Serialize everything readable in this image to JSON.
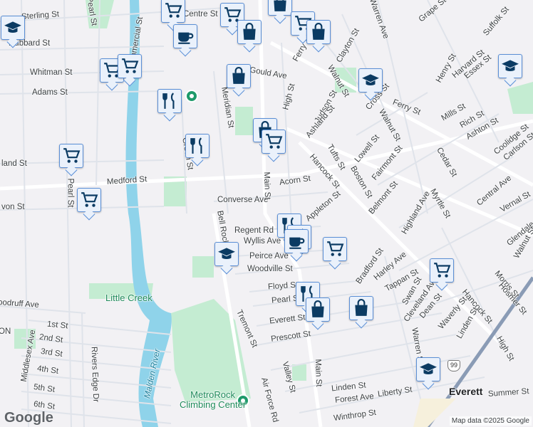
{
  "map": {
    "streets": [
      "Sterling St",
      "Hubbard St",
      "Whitman St",
      "Adams St",
      "Medford St",
      "Pearl St",
      "Converse Ave",
      "Acorn St",
      "Main St",
      "Regent Rd",
      "Wyllis Ave",
      "Bell Rock",
      "Peirce Ave",
      "Woodville St",
      "Floyd St",
      "Pearl St",
      "Everett St",
      "Prescott St",
      "Tremont St",
      "Valley St",
      "Air Force Rd",
      "Main St",
      "Linden St",
      "Forest Ave",
      "Liberty St",
      "Winthrop St",
      "Summer St",
      "Middlesex Ave",
      "Rivers Edge Dr",
      "1st St",
      "2nd St",
      "3rd St",
      "4th St",
      "5th St",
      "6th St",
      "oodruff Ave",
      "Meridian St",
      "Green St",
      "Commercial St",
      "Pearl St",
      "Centre St",
      "Ferry St",
      "High St",
      "Judson St",
      "Ashland St",
      "Walnut St",
      "Clayton St",
      "Cross St",
      "Ferry St",
      "Walnut St",
      "Tufts St",
      "Hancock St",
      "Lowell St",
      "Boston St",
      "Fairmont St",
      "Belmont St",
      "Appleton St",
      "Cedar St",
      "Myrtle St",
      "Highland Ave",
      "Central Ave",
      "Vernal St",
      "Glendale St",
      "Walnut St",
      "Harley Ave",
      "Bradford St",
      "Tappan St",
      "Swan St",
      "Cleveland Ave",
      "Dean St",
      "Waverly St",
      "Hancock St",
      "Morris St",
      "Hosmer St",
      "Linden St",
      "High St",
      "Warren St",
      "Coolidge St",
      "Carlson St",
      "Ashton St",
      "Rich St",
      "Mills St",
      "Essex St",
      "Harvard St",
      "Henry St",
      "Suffolk St",
      "Grape St",
      "Warren Ave",
      "Gould Ave",
      "land St",
      "von St",
      "ON"
    ],
    "places": {
      "little_creek": "Little Creek",
      "malden_river": "Malden River",
      "metrorock": "MetroRock\nClimbing Center",
      "everett": "Everett"
    },
    "route_shield": "99",
    "google_logo": "Google",
    "attribution": "Map data ©2025 Google"
  },
  "colors": {
    "park": "#c4ecd2",
    "water": "#8fd3ea",
    "marker_border": "#5b8fd6",
    "icon": "#0b3b63",
    "poi": "#1e9a6a"
  }
}
